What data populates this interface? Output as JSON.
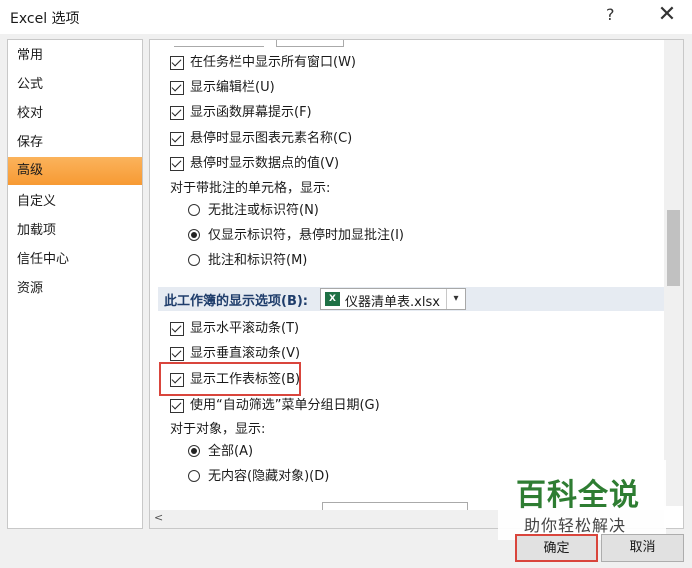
{
  "window": {
    "title": "Excel 选项",
    "help_glyph": "?",
    "close_glyph": "✕"
  },
  "nav": {
    "items": [
      {
        "label": "常用",
        "active": false
      },
      {
        "label": "公式",
        "active": false
      },
      {
        "label": "校对",
        "active": false
      },
      {
        "label": "保存",
        "active": false
      },
      {
        "label": "高级",
        "active": true
      },
      {
        "label": "自定义",
        "active": false
      },
      {
        "label": "加载项",
        "active": false
      },
      {
        "label": "信任中心",
        "active": false
      },
      {
        "label": "资源",
        "active": false
      }
    ]
  },
  "options": {
    "show_all_windows_taskbar": "在任务栏中显示所有窗口(W)",
    "show_formula_bar": "显示编辑栏(U)",
    "show_function_tooltips": "显示函数屏幕提示(F)",
    "hover_chart_element_names": "悬停时显示图表元素名称(C)",
    "hover_data_point_values": "悬停时显示数据点的值(V)",
    "comments_heading": "对于带批注的单元格，显示:",
    "no_comments_or_indicators": "无批注或标识符(N)",
    "indicators_only": "仅显示标识符，悬停时加显批注(I)",
    "comments_and_indicators": "批注和标识符(M)"
  },
  "workbook_section": {
    "label": "此工作簿的显示选项(B):",
    "selected_workbook": "仪器清单表.xlsx",
    "file_icon_letter": "X",
    "dropdown_glyph": "▾",
    "show_horizontal_scrollbar": "显示水平滚动条(T)",
    "show_vertical_scrollbar": "显示垂直滚动条(V)",
    "show_sheet_tabs": "显示工作表标签(B)",
    "group_dates_autofilter": "使用“自动筛选”菜单分组日期(G)",
    "objects_heading": "对于对象，显示:",
    "objects_all": "全部(A)",
    "objects_nothing": "无内容(隐藏对象)(D)"
  },
  "scroll": {
    "left_arrow": "<"
  },
  "buttons": {
    "ok": "确定",
    "cancel": "取消"
  },
  "watermark": {
    "brand": "百科全说",
    "tagline": "助你轻松解决"
  }
}
